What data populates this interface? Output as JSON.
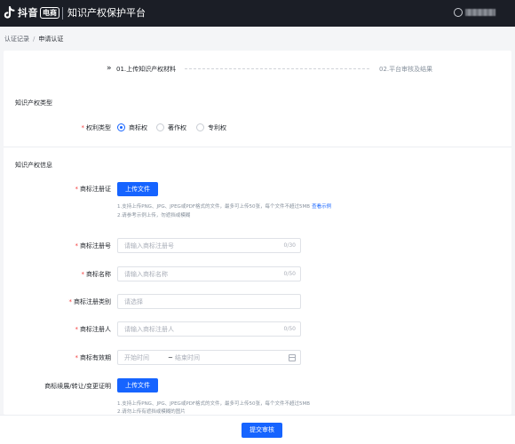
{
  "header": {
    "brand_name": "抖音",
    "brand_badge": "电商",
    "platform_title": "知识产权保护平台"
  },
  "breadcrumb": {
    "items": [
      "认证记录",
      "申请认证"
    ],
    "separator": "/"
  },
  "steps": {
    "step1": "01.上传知识产权材料",
    "step2": "02.平台审核及结果"
  },
  "section_type": {
    "title": "知识产权类型",
    "right_type_label": "权利类型",
    "options": [
      "商标权",
      "著作权",
      "专利权"
    ],
    "selected": "商标权"
  },
  "section_info": {
    "title": "知识产权信息",
    "registration_cert": {
      "label": "商标注册证",
      "button": "上传文件",
      "hint_line1": "1.支持上传PNG、JPG、JPEG或PDF格式的文件，最多可上传50张，每个文件不超过5MB",
      "hint_link": "查看示例",
      "hint_line2": "2.请参考示例上传，勿遮挡或模糊"
    },
    "registration_no": {
      "label": "商标注册号",
      "placeholder": "请输入商标注册号",
      "counter": "0/30"
    },
    "trademark_name": {
      "label": "商标名称",
      "placeholder": "请输入商标名称",
      "counter": "0/50"
    },
    "category": {
      "label": "商标注册类别",
      "placeholder": "请选择"
    },
    "registrant": {
      "label": "商标注册人",
      "placeholder": "请输入商标注册人",
      "counter": "0/50"
    },
    "validity": {
      "label": "商标有效期",
      "start_placeholder": "开始时间",
      "separator": "~",
      "end_placeholder": "结束时间"
    },
    "renewal_proof": {
      "label": "商标续展/转让/变更证明",
      "button": "上传文件",
      "hint_line1": "1.支持上传PNG、JPG、JPEG或PDF格式的文件，最多可上传50张，每个文件不超过5MB",
      "hint_line2": "2.请勿上传有遮挡或模糊的图片"
    }
  },
  "footer": {
    "submit": "提交审核"
  },
  "colors": {
    "accent": "#1664ff",
    "required": "#f53f3f",
    "header_bg": "#1b1e26"
  }
}
